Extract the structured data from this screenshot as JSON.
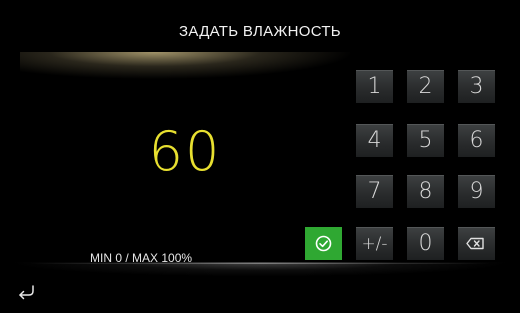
{
  "header": {
    "title": "ЗАДАТЬ ВЛАЖНОСТЬ"
  },
  "display": {
    "value": "60",
    "range": "MIN  0 / MAX 100%"
  },
  "keypad": {
    "k1": "1",
    "k2": "2",
    "k3": "3",
    "k4": "4",
    "k5": "5",
    "k6": "6",
    "k7": "7",
    "k8": "8",
    "k9": "9",
    "sign": "+/-",
    "k0": "0",
    "confirm_icon": "check-circle-icon",
    "backspace_icon": "backspace-icon"
  },
  "footer": {
    "back_icon": "return-arrow-icon"
  },
  "colors": {
    "value": "#e8e030",
    "confirm": "#2fa832",
    "background": "#000000"
  }
}
